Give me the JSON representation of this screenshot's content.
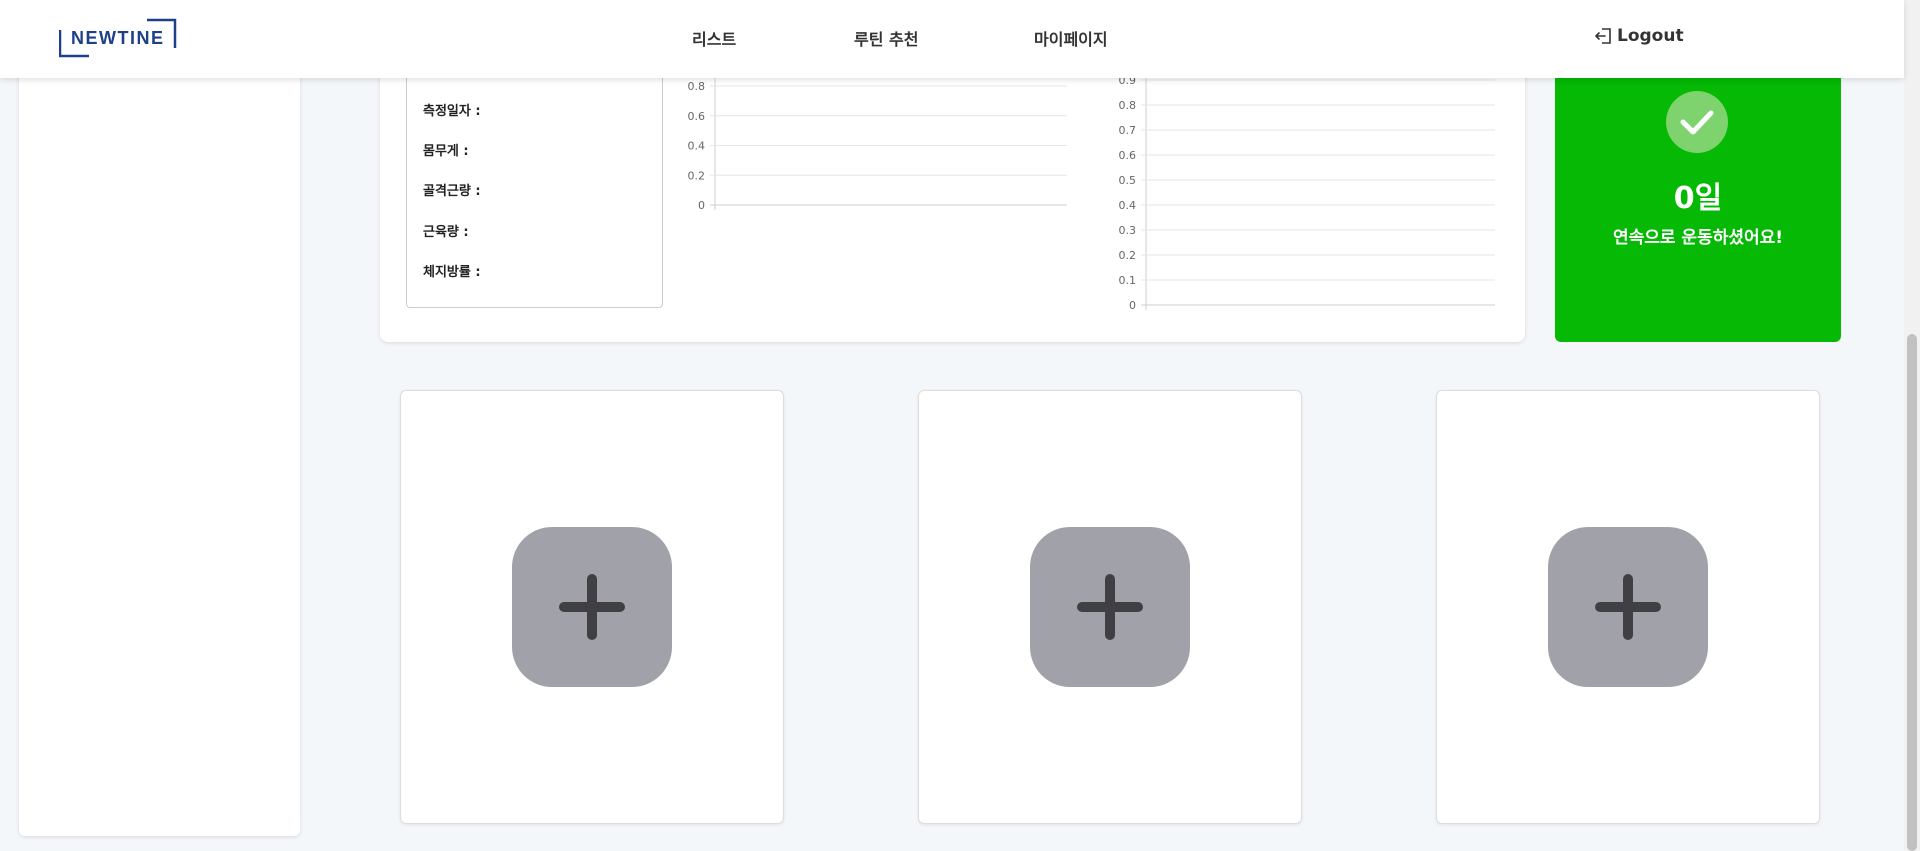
{
  "header": {
    "logo_text": "NEWTINE",
    "nav": [
      "리스트",
      "루틴 추천",
      "마이페이지"
    ],
    "logout_label": "Logout"
  },
  "info": {
    "measure_date": "측정일자 :",
    "weight": "몸무게 :",
    "skeletal_muscle": "골격근량 :",
    "muscle_mass": "근육량 :",
    "body_fat": "체지방률 :"
  },
  "chart_data": [
    {
      "type": "line",
      "series": [],
      "y_ticks": [
        "0",
        "0.2",
        "0.4",
        "0.6",
        "0.8"
      ],
      "ylim": [
        0,
        0.8
      ],
      "grid": true
    },
    {
      "type": "line",
      "series": [],
      "y_ticks": [
        "0",
        "0.1",
        "0.2",
        "0.3",
        "0.4",
        "0.5",
        "0.6",
        "0.7",
        "0.8",
        "0.9"
      ],
      "ylim": [
        0,
        0.9
      ],
      "grid": true
    }
  ],
  "streak": {
    "days": "0일",
    "message": "연속으로 운동하셨어요!",
    "color": "#05b905"
  },
  "add_cards": [
    {
      "icon": "plus-icon"
    },
    {
      "icon": "plus-icon"
    },
    {
      "icon": "plus-icon"
    }
  ]
}
